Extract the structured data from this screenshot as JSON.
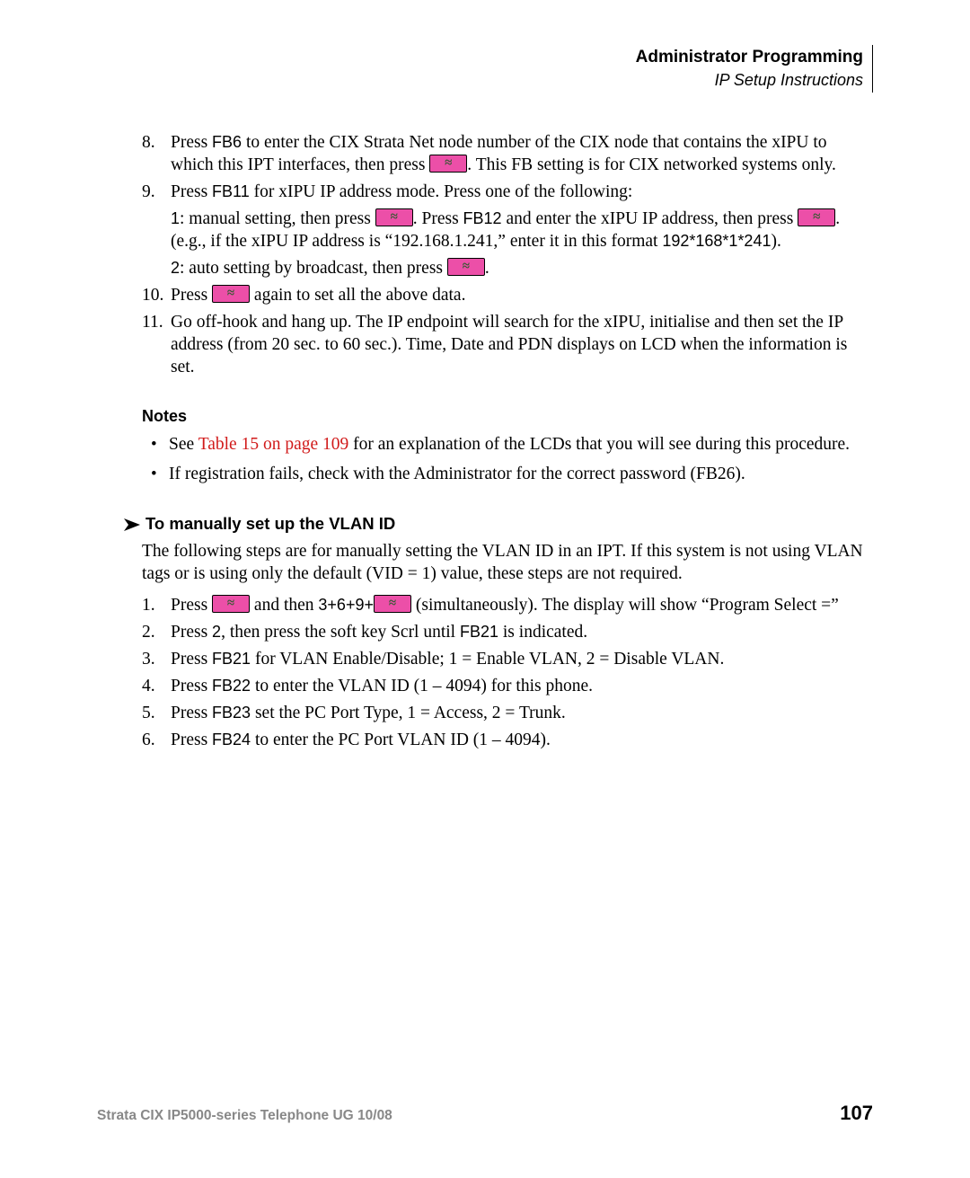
{
  "header": {
    "title": "Administrator Programming",
    "subtitle": "IP Setup Instructions"
  },
  "steps": {
    "s8": {
      "num": "8.",
      "t1": "Press ",
      "fb": "FB6",
      "t2": " to enter the CIX Strata Net node number of the CIX node that contains the xIPU to which this IPT interfaces, then press ",
      "t3": ". This FB setting is for CIX networked systems only."
    },
    "s9": {
      "num": "9.",
      "t1": "Press ",
      "fb": "FB11",
      "t2": " for xIPU IP address mode. Press one of the following:",
      "sub1a": "1",
      "sub1b": ": manual setting, then press ",
      "sub1c": ". Press ",
      "fb12": "FB12",
      "sub1d": " and enter the xIPU IP address, then press ",
      "sub1e": ". (e.g., if the xIPU IP address is “192.168.1.241,” enter it in this format ",
      "fmt": "192*168*1*241",
      "sub1f": ").",
      "sub2a": "2",
      "sub2b": ": auto setting by broadcast, then press ",
      "sub2c": "."
    },
    "s10": {
      "num": "10.",
      "t1": "Press ",
      "t2": " again to set all the above data."
    },
    "s11": {
      "num": "11.",
      "t1": "Go off-hook and hang up. The IP endpoint will search for the xIPU, initialise and then set the IP address (from 20 sec. to 60 sec.). Time, Date and PDN displays on LCD when the information is set."
    }
  },
  "notesHeading": "Notes",
  "notes": {
    "n1a": "See ",
    "n1link": "Table 15 on page 109",
    "n1b": " for an explanation of the LCDs that you will see during this procedure.",
    "n2": "If registration fails, check with the Administrator for the correct password (FB26)."
  },
  "vlan": {
    "heading": "To manually set up the VLAN ID",
    "intro": "The following steps are for manually setting the VLAN ID in an IPT. If this system is not using VLAN tags or is using only the default (VID = 1) value, these steps are not required.",
    "v1": {
      "num": "1.",
      "t1": "Press ",
      "t2": " and then ",
      "combo": "3+6+9+",
      "t3": " (simultaneously).  The display will show “Program Select =”"
    },
    "v2": {
      "num": "2.",
      "t1": "Press ",
      "key": "2",
      "t2": ", then press the soft key Scrl until ",
      "fb": "FB21",
      "t3": " is indicated."
    },
    "v3": {
      "num": "3.",
      "t1": "Press ",
      "fb": "FB21",
      "t2": " for VLAN Enable/Disable; 1 = Enable VLAN, 2 = Disable VLAN."
    },
    "v4": {
      "num": "4.",
      "t1": "Press ",
      "fb": "FB22",
      "t2": " to enter the VLAN ID (1 – 4094) for this phone."
    },
    "v5": {
      "num": "5.",
      "t1": "Press ",
      "fb": "FB23",
      "t2": " set the PC Port Type, 1 = Access, 2 = Trunk."
    },
    "v6": {
      "num": "6.",
      "t1": "Press ",
      "fb": "FB24",
      "t2": " to enter the PC Port VLAN ID (1 – 4094)."
    }
  },
  "footer": {
    "left": "Strata CIX IP5000-series Telephone UG    10/08",
    "page": "107"
  }
}
